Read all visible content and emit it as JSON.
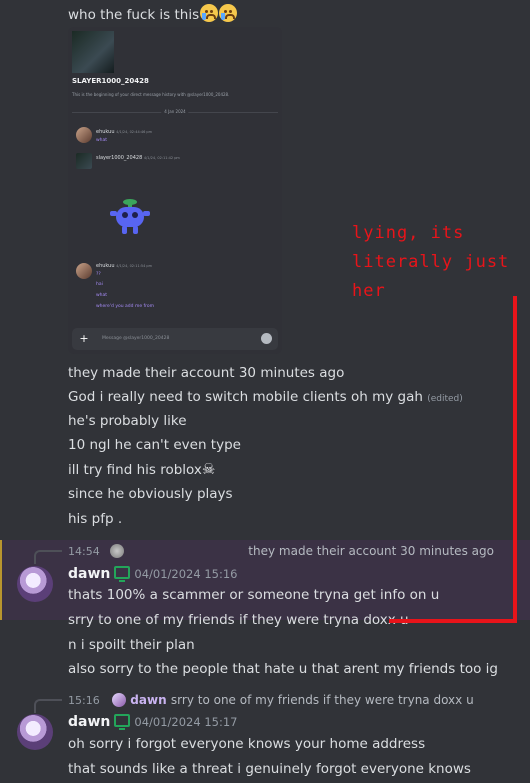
{
  "messages_top": {
    "line0": "who the fuck is this",
    "emoji_name": "loudly-crying-face",
    "lines": [
      "they made their account 30 minutes ago",
      "God i really need to switch mobile clients oh my gah",
      "he's probably like",
      "10 ngl he can't even type",
      "ill try find his roblox",
      "since he obviously plays",
      "his pfp ."
    ],
    "edited_tag": "(edited)",
    "skull_glyph": "☠"
  },
  "screenshot": {
    "profile_name": "SLAYER1000_20428",
    "profile_sub": "This is the beginning of your direct message history with @slayer1000_20428.",
    "date_sep": "4 Jan 2024",
    "m1_user": "ehukuu",
    "m1_time": "4/1/24, 02:44:46 pm",
    "m1_text": "what",
    "m2_user": "slayer1000_20428",
    "m2_time": "4/1/24, 02:11:42 pm",
    "m3_user": "ehukuu",
    "m3_time": "4/1/24, 02:11:54 pm",
    "m3_lines": [
      "??",
      "hai",
      "what",
      "where'd you add me from"
    ],
    "input_placeholder": "Message @slayer1000_20428",
    "plus": "+"
  },
  "annotation": {
    "lines": [
      "lying, its",
      "literally just",
      "her"
    ],
    "color": "#e8141a"
  },
  "reply1": {
    "time": "14:54",
    "quoted": "they made their account 30 minutes ago"
  },
  "msg_dawn1": {
    "author": "dawn",
    "timestamp": "04/01/2024 15:16",
    "lines": [
      "thats 100% a scammer or someone tryna get info on u",
      "srry to one of my friends if they were tryna doxx u",
      "n i spoilt their plan",
      "also sorry to the people that hate u that arent my friends too ig"
    ]
  },
  "reply2": {
    "time": "15:16",
    "author": "dawn",
    "quoted": "srry to one of my friends if they were tryna doxx u"
  },
  "msg_dawn2": {
    "author": "dawn",
    "timestamp": "04/01/2024 15:17",
    "lines": [
      "oh sorry i forgot everyone knows your home address",
      "that sounds like a threat i genuinely forgot everyone knows"
    ]
  },
  "colors": {
    "background": "#313338",
    "highlight": "#3b3245",
    "online": "#23a55a",
    "screenshot_link": "#a58bf5"
  }
}
